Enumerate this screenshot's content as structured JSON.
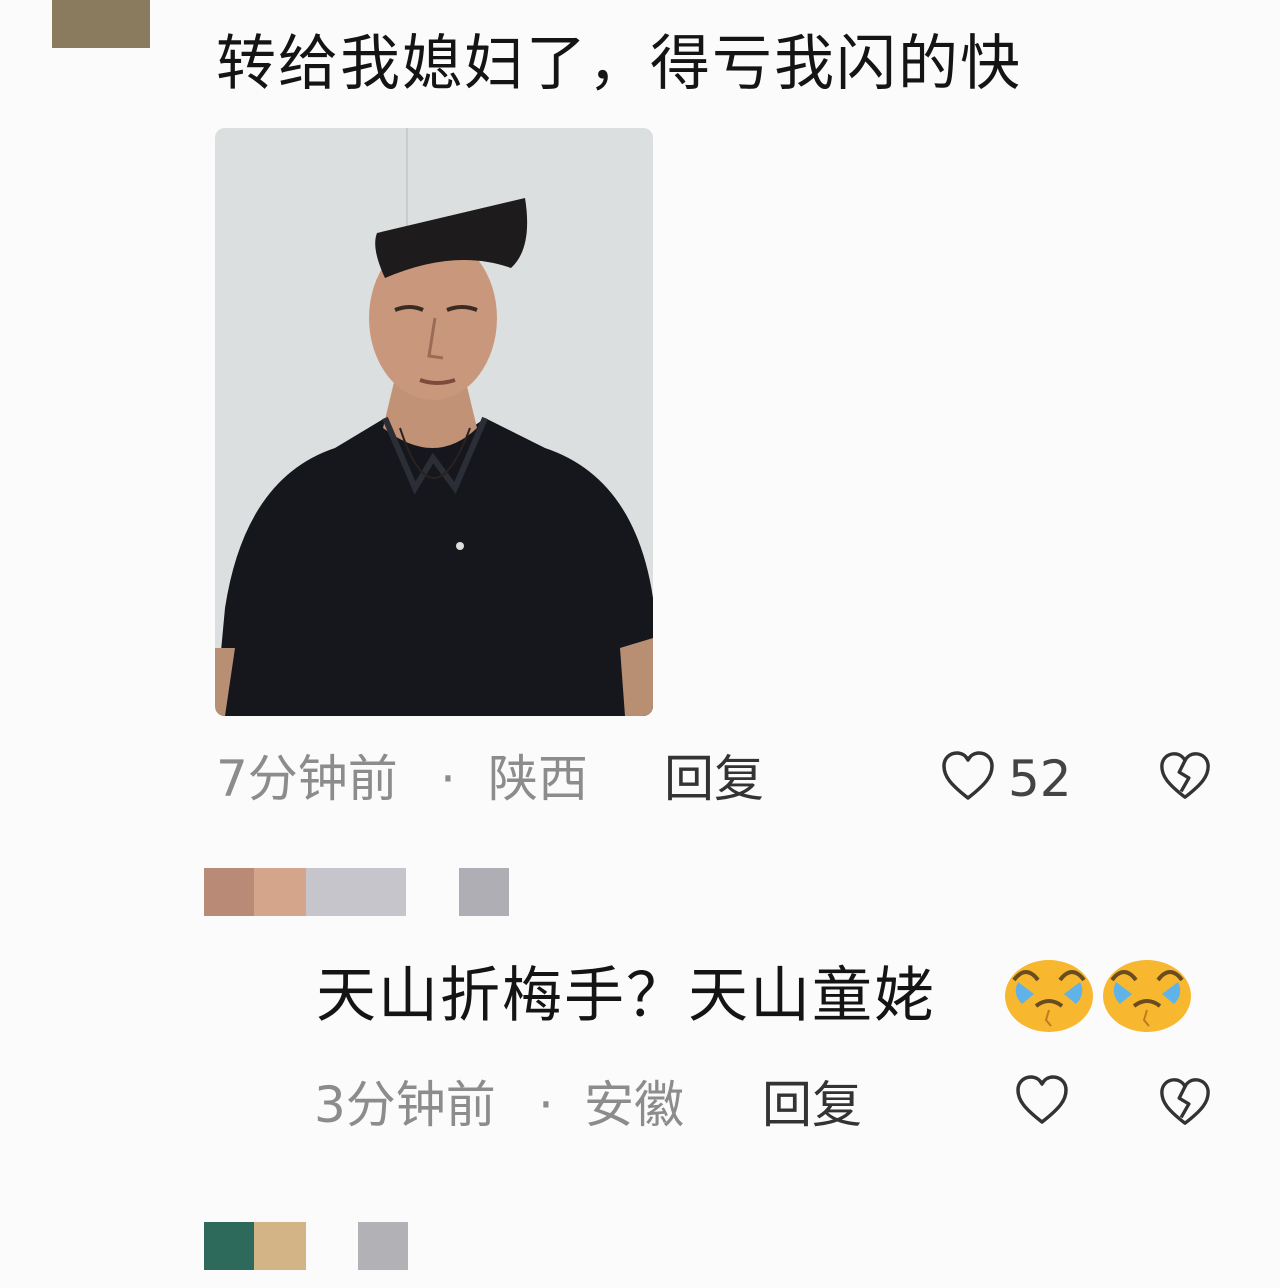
{
  "comment1": {
    "text": "转给我媳妇了，得亏我闪的快",
    "time": "7分钟前",
    "separator": "·",
    "location": "陕西",
    "reply_label": "回复",
    "like_count": "52",
    "like_icon": "heart-outline-icon",
    "dislike_icon": "broken-heart-icon"
  },
  "comment2": {
    "text": "天山折梅手？天山童姥",
    "emojis": [
      "crying-face-emoji",
      "crying-face-emoji"
    ],
    "time": "3分钟前",
    "separator": "·",
    "location": "安徽",
    "reply_label": "回复",
    "like_icon": "heart-outline-icon",
    "dislike_icon": "broken-heart-icon"
  },
  "colors": {
    "background": "#fbfbfb",
    "meta_text": "#8c8c8c",
    "main_text": "#141414"
  }
}
